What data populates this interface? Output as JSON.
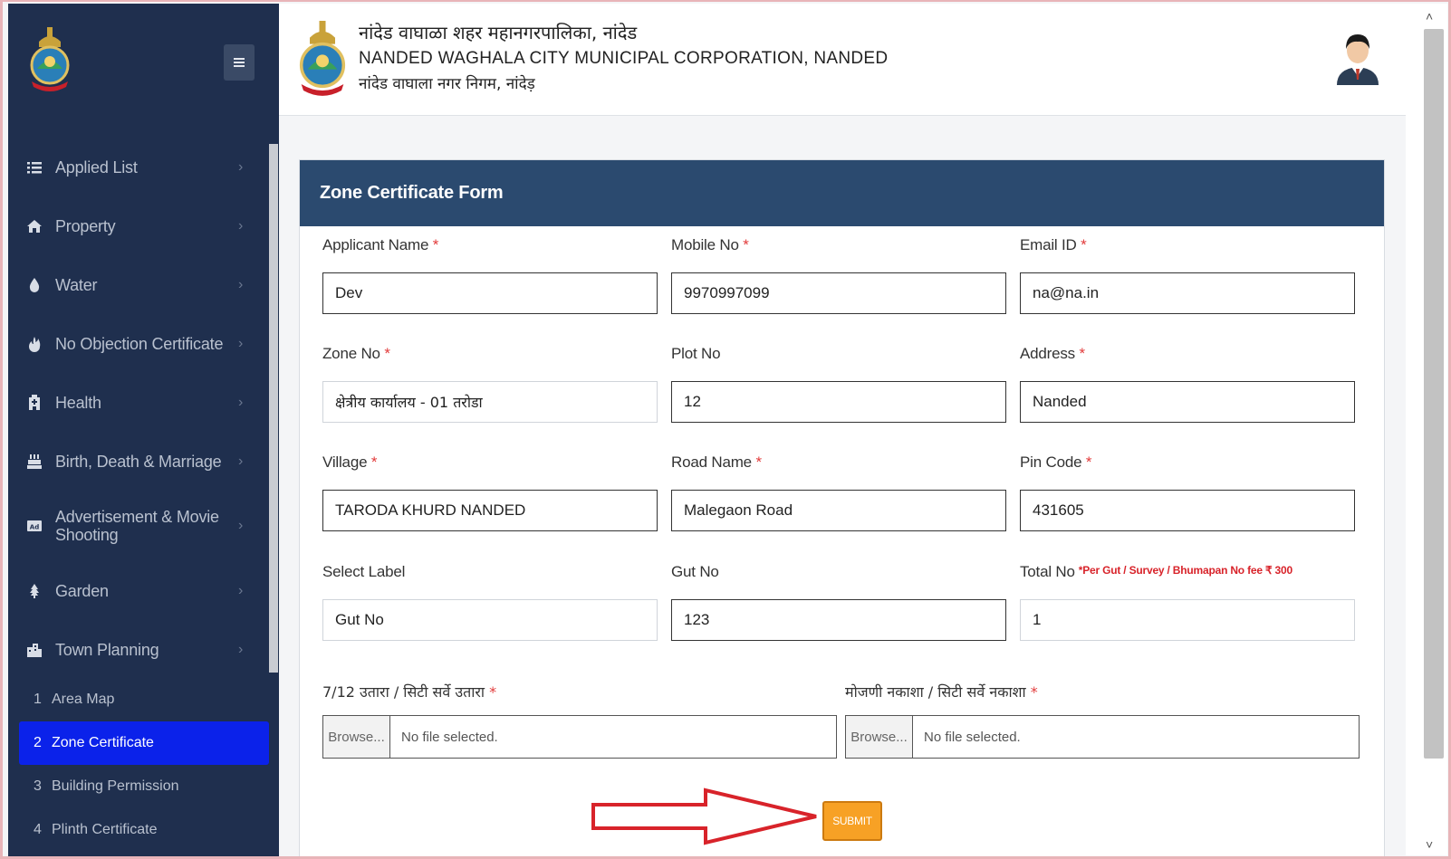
{
  "header": {
    "org_name_marathi": "नांदेड वाघाळा शहर महानगरपालिका, नांदेड",
    "org_name_english": "NANDED WAGHALA CITY MUNICIPAL CORPORATION, NANDED",
    "org_name_hindi": "नांदेड वाघाला नगर निगम, नांदेड़"
  },
  "sidebar": {
    "menu_icon": "hamburger-icon",
    "items": [
      {
        "label": "Applied List",
        "icon": "list-icon"
      },
      {
        "label": "Property",
        "icon": "home-icon"
      },
      {
        "label": "Water",
        "icon": "water-drop-icon"
      },
      {
        "label": "No Objection Certificate",
        "icon": "fire-icon"
      },
      {
        "label": "Health",
        "icon": "hospital-icon"
      },
      {
        "label": "Birth, Death & Marriage",
        "icon": "cake-icon"
      },
      {
        "label": "Advertisement & Movie Shooting",
        "icon": "ad-icon"
      },
      {
        "label": "Garden",
        "icon": "tree-icon"
      },
      {
        "label": "Town Planning",
        "icon": "city-icon"
      }
    ],
    "sub_items": [
      {
        "num": "1",
        "label": "Area Map"
      },
      {
        "num": "2",
        "label": "Zone Certificate"
      },
      {
        "num": "3",
        "label": "Building Permission"
      },
      {
        "num": "4",
        "label": "Plinth Certificate"
      }
    ]
  },
  "form": {
    "title": "Zone Certificate Form",
    "required_mark": "*",
    "fields": {
      "applicant_name": {
        "label": "Applicant Name",
        "value": "Dev"
      },
      "mobile_no": {
        "label": "Mobile No",
        "value": "9970997099"
      },
      "email_id": {
        "label": "Email ID",
        "value": "na@na.in"
      },
      "zone_no": {
        "label": "Zone No",
        "value": "क्षेत्रीय कार्यालय - 01 तरोडा"
      },
      "plot_no": {
        "label": "Plot No",
        "value": "12"
      },
      "address": {
        "label": "Address",
        "value": "Nanded"
      },
      "village": {
        "label": "Village",
        "value": "TARODA KHURD NANDED"
      },
      "road_name": {
        "label": "Road Name",
        "value": "Malegaon Road"
      },
      "pin_code": {
        "label": "Pin Code",
        "value": "431605"
      },
      "select_label": {
        "label": "Select Label",
        "value": "Gut No"
      },
      "gut_no": {
        "label": "Gut No",
        "value": "123"
      },
      "total_no": {
        "label": "Total No",
        "value": "1",
        "note": "*Per Gut / Survey / Bhumapan No fee ₹ 300"
      }
    },
    "uploads": {
      "doc_712": {
        "label": "7/12 उतारा / सिटी सर्वे उतारा",
        "button": "Browse...",
        "status": "No file selected."
      },
      "doc_map": {
        "label": "मोजणी नकाशा / सिटी सर्वे नकाशा",
        "button": "Browse...",
        "status": "No file selected."
      }
    },
    "submit_label": "SUBMIT"
  },
  "colors": {
    "sidebar_bg": "#1f2f4e",
    "card_header_bg": "#2b4a6f",
    "active_item_bg": "#0b22ea",
    "submit_bg": "#f7a125",
    "required_red": "#e23b3b",
    "annotation_arrow": "#d8232a"
  }
}
